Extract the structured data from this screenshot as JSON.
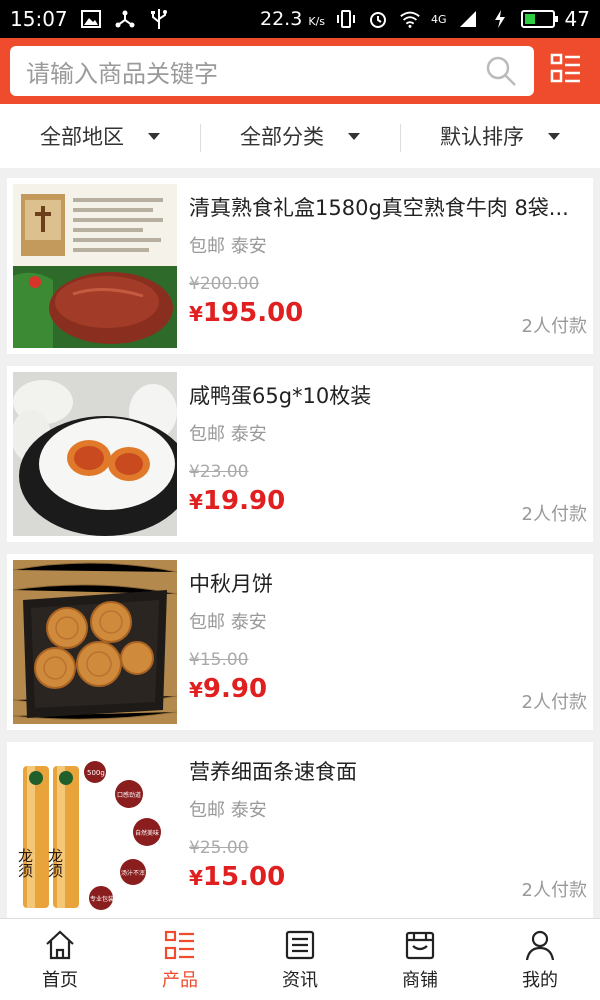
{
  "status_bar": {
    "time": "15:07",
    "speed": "22.3",
    "speed_unit": "K/s",
    "network": "4G",
    "battery": "47",
    "battery_level": 0.47
  },
  "search": {
    "placeholder": "请输入商品关键字"
  },
  "filters": [
    {
      "label": "全部地区"
    },
    {
      "label": "全部分类"
    },
    {
      "label": "默认排序"
    }
  ],
  "products": [
    {
      "name": "清真熟食礼盒1580g真空熟食牛肉 8袋...",
      "shipping": "包邮",
      "location": "泰安",
      "old_price": "¥200.00",
      "currency": "¥",
      "price": "195.00",
      "paid": "2人付款",
      "image": "beef-gift-box"
    },
    {
      "name": "咸鸭蛋65g*10枚装",
      "shipping": "包邮",
      "location": "泰安",
      "old_price": "¥23.00",
      "currency": "¥",
      "price": "19.90",
      "paid": "2人付款",
      "image": "salted-duck-egg"
    },
    {
      "name": "中秋月饼",
      "shipping": "包邮",
      "location": "泰安",
      "old_price": "¥15.00",
      "currency": "¥",
      "price": "9.90",
      "paid": "2人付款",
      "image": "mooncakes"
    },
    {
      "name": "营养细面条速食面",
      "shipping": "包邮",
      "location": "泰安",
      "old_price": "¥25.00",
      "currency": "¥",
      "price": "15.00",
      "paid": "2人付款",
      "image": "noodle-tubes",
      "image_text": {
        "brand": "龙须",
        "badges": [
          "500g",
          "口感劲道",
          "自然美味",
          "汤汁不浑",
          "专业包装"
        ]
      }
    }
  ],
  "bottom_nav": [
    {
      "label": "首页",
      "icon": "home-icon",
      "active": false
    },
    {
      "label": "产品",
      "icon": "grid-list-icon",
      "active": true
    },
    {
      "label": "资讯",
      "icon": "news-icon",
      "active": false
    },
    {
      "label": "商铺",
      "icon": "store-icon",
      "active": false
    },
    {
      "label": "我的",
      "icon": "user-icon",
      "active": false
    }
  ],
  "colors": {
    "accent": "#ee4c2c",
    "price": "#e02020"
  }
}
